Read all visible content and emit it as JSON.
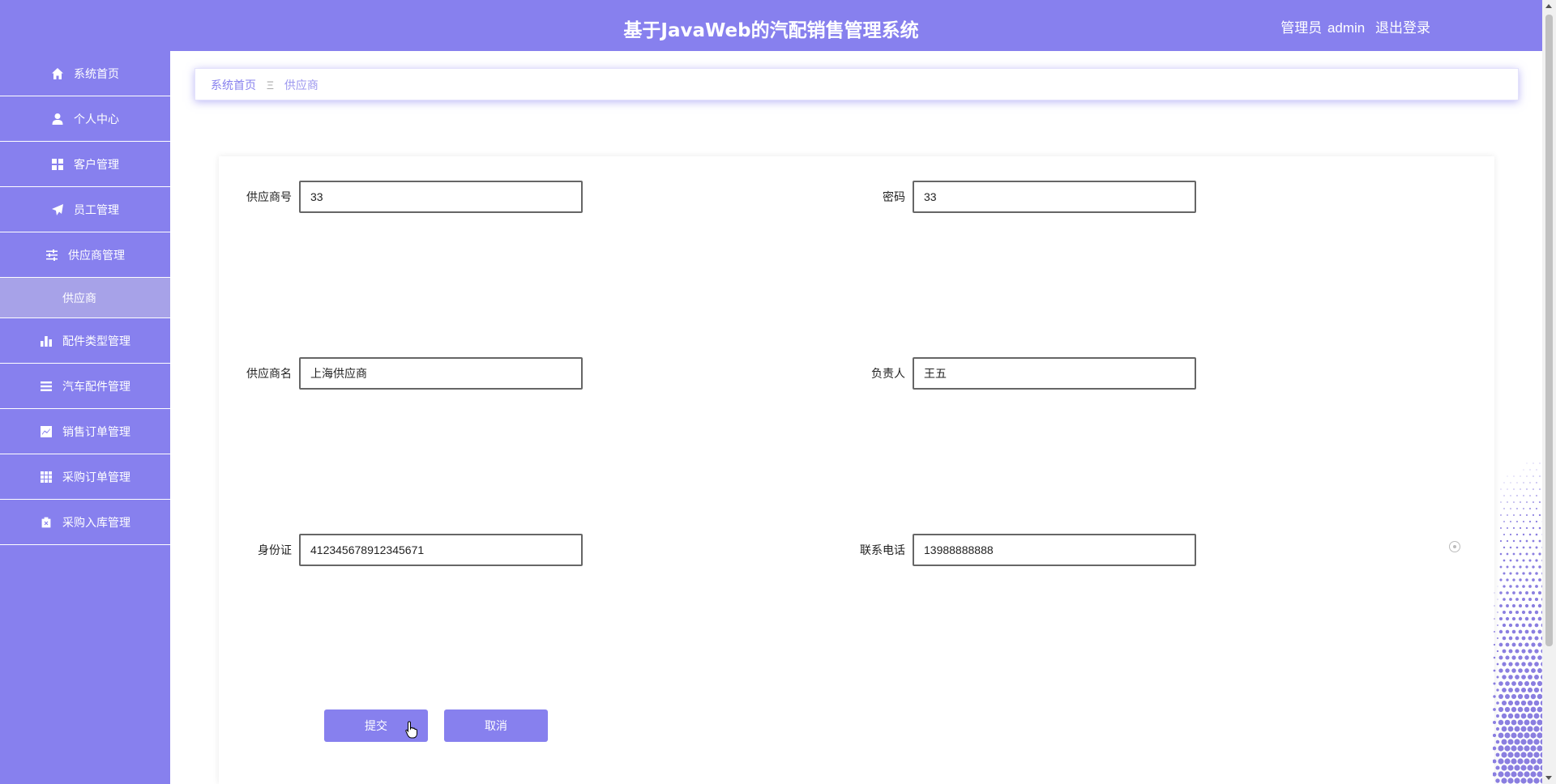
{
  "header": {
    "title": "基于JavaWeb的汽配销售管理系统",
    "role": "管理员",
    "username": "admin",
    "logout": "退出登录"
  },
  "sidebar": {
    "items": [
      {
        "label": "系统首页",
        "icon": "home-icon"
      },
      {
        "label": "个人中心",
        "icon": "user-icon"
      },
      {
        "label": "客户管理",
        "icon": "grid-icon"
      },
      {
        "label": "员工管理",
        "icon": "send-icon"
      },
      {
        "label": "供应商管理",
        "icon": "sliders-icon"
      },
      {
        "label": "配件类型管理",
        "icon": "bar-chart-icon"
      },
      {
        "label": "汽车配件管理",
        "icon": "list-icon"
      },
      {
        "label": "销售订单管理",
        "icon": "line-chart-icon"
      },
      {
        "label": "采购订单管理",
        "icon": "table-icon"
      },
      {
        "label": "采购入库管理",
        "icon": "clipboard-icon"
      }
    ],
    "sub_active": "供应商"
  },
  "breadcrumb": {
    "home": "系统首页",
    "separator": "Ξ",
    "current": "供应商"
  },
  "form": {
    "supplier_no": {
      "label": "供应商号",
      "value": "33"
    },
    "password": {
      "label": "密码",
      "value": "33"
    },
    "supplier_name": {
      "label": "供应商名",
      "value": "上海供应商"
    },
    "manager": {
      "label": "负责人",
      "value": "王五"
    },
    "id_card": {
      "label": "身份证",
      "value": "412345678912345671"
    },
    "phone": {
      "label": "联系电话",
      "value": "13988888888"
    },
    "submit": "提交",
    "cancel": "取消"
  },
  "colors": {
    "primary": "#8780ee",
    "submenu_active": "#a7a2e8"
  }
}
